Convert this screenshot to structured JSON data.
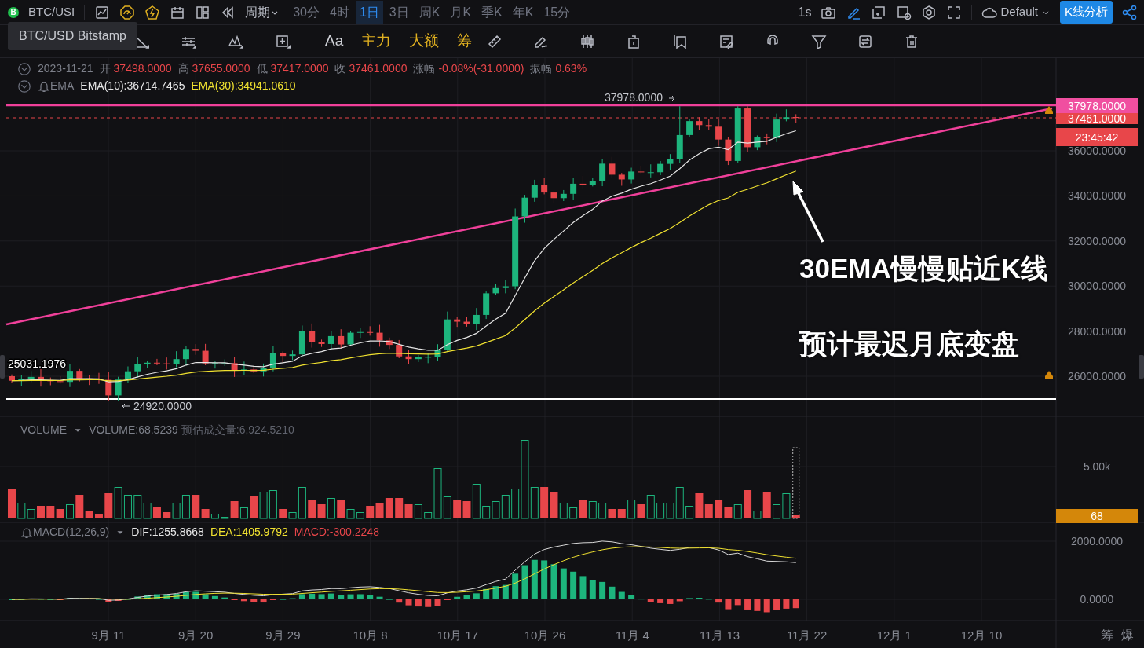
{
  "toolbar": {
    "logo_letter": "B",
    "symbol": "BTC/USI",
    "period": "周期",
    "intervals": [
      {
        "label": "30分",
        "selected": false
      },
      {
        "label": "4时",
        "selected": false
      },
      {
        "label": "1日",
        "selected": true
      },
      {
        "label": "3日",
        "selected": false
      },
      {
        "label": "周K",
        "selected": false
      },
      {
        "label": "月K",
        "selected": false
      },
      {
        "label": "季K",
        "selected": false
      },
      {
        "label": "年K",
        "selected": false
      },
      {
        "label": "15分",
        "selected": false
      }
    ],
    "refresh": "1s",
    "theme": "Default",
    "analysis_button": "K线分析"
  },
  "tooltip": "BTC/USD Bitstamp",
  "drawing_tools": [
    {
      "kind": "text",
      "label": "Aa"
    },
    {
      "kind": "indicator",
      "label": "主力"
    },
    {
      "kind": "indicator",
      "label": "大额"
    },
    {
      "kind": "indicator",
      "label": "筹"
    }
  ],
  "ohlc": {
    "date": "2023-11-21",
    "fields": [
      {
        "label": "开",
        "value": "37498.0000"
      },
      {
        "label": "高",
        "value": "37655.0000"
      },
      {
        "label": "低",
        "value": "37417.0000"
      },
      {
        "label": "收",
        "value": "37461.0000"
      },
      {
        "label": "涨幅",
        "value": "-0.08%(-31.0000)"
      },
      {
        "label": "振幅",
        "value": "0.63%"
      }
    ]
  },
  "ema": {
    "name": "EMA",
    "lines": [
      {
        "label": "EMA(10):36714.7465",
        "color": "#e6e6e6"
      },
      {
        "label": "EMA(30):34941.0610",
        "color": "#f0e130"
      }
    ]
  },
  "price_chart": {
    "y_ticks": [
      "36000.0000",
      "34000.0000",
      "32000.0000",
      "30000.0000",
      "28000.0000",
      "26000.0000"
    ],
    "price_tags": [
      {
        "kind": "high",
        "text": "37978.0000"
      },
      {
        "kind": "last",
        "text": "37461.0000"
      },
      {
        "kind": "countdown",
        "text": "23:45:42"
      }
    ],
    "high_marker": "37978.0000",
    "low_marker": "24920.0000",
    "left_label": "25031.1976",
    "annotations": [
      "30EMA慢慢贴近K线",
      "预计最迟月底变盘"
    ]
  },
  "volume": {
    "title": "VOLUME",
    "value": "VOLUME:68.5239",
    "estimate": "预估成交量:6,924.5210",
    "y_tick": "5.00k",
    "last_tag": "68"
  },
  "macd": {
    "title": "MACD(12,26,9)",
    "dif": "DIF:1255.8668",
    "dea": "DEA:1405.9792",
    "macd": "MACD:-300.2248",
    "y_ticks": [
      "2000.0000",
      "0.0000"
    ]
  },
  "x_axis": [
    "9月 11",
    "9月 20",
    "9月 29",
    "10月 8",
    "10月 17",
    "10月 26",
    "11月 4",
    "11月 13",
    "11月 22",
    "12月 1",
    "12月 10"
  ],
  "footer_buttons": [
    "筹",
    "爆"
  ]
}
